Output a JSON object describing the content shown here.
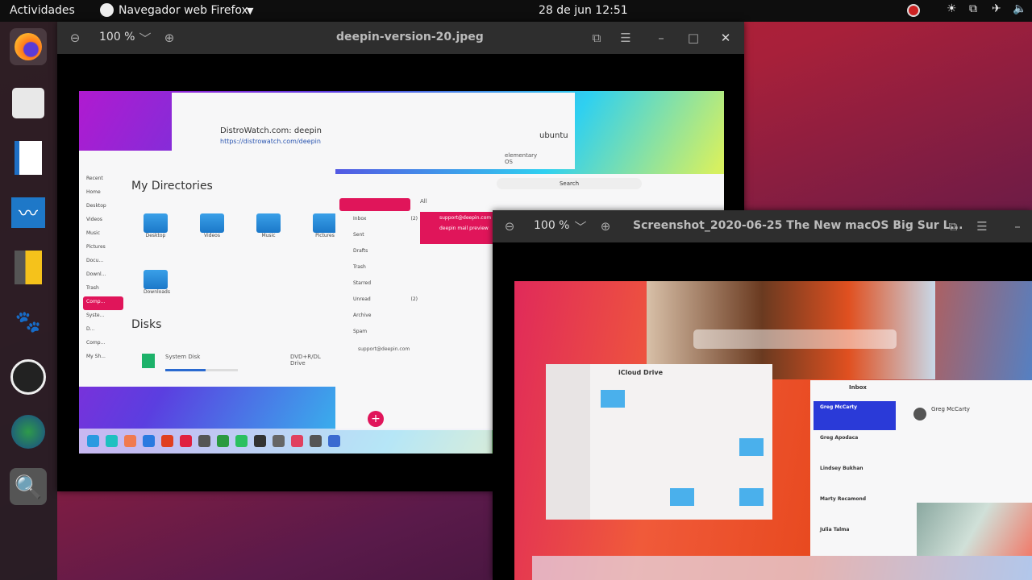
{
  "topbar": {
    "activities": "Actividades",
    "app_menu": "Navegador web Firefox",
    "clock": "28 de jun  12:51"
  },
  "dock": {
    "items": [
      "firefox",
      "files",
      "writer",
      "system-monitor",
      "notes",
      "gimp",
      "obs",
      "globe",
      "search"
    ]
  },
  "window1": {
    "zoom": "100 %",
    "title": "deepin-version-20.jpeg",
    "image": {
      "browser_title": "DistroWatch.com: deepin",
      "browser_url": "https://distrowatch.com/deepin",
      "ubuntu": "ubuntu",
      "elementary": "elementary OS",
      "fm_title": "My Directories",
      "fm_sidebar": [
        "Recent",
        "Home",
        "Desktop",
        "Videos",
        "Music",
        "Pictures",
        "Docu...",
        "Downl...",
        "Trash",
        "Comp...",
        "Syste...",
        "D...",
        "Comp...",
        "My Sh..."
      ],
      "folders": [
        "Desktop",
        "Videos",
        "Music",
        "Pictures",
        "Downloads"
      ],
      "disks_title": "Disks",
      "disk1": "System Disk",
      "disk2": "DVD+R/DL Drive",
      "mail_search": "Search",
      "mail_filter": "All",
      "mail_folders": [
        {
          "name": "Inbox",
          "count": "(2)"
        },
        {
          "name": "Sent",
          "count": ""
        },
        {
          "name": "Drafts",
          "count": ""
        },
        {
          "name": "Trash",
          "count": ""
        },
        {
          "name": "Starred",
          "count": ""
        },
        {
          "name": "Unread",
          "count": "(2)"
        },
        {
          "name": "Archive",
          "count": ""
        },
        {
          "name": "Spam",
          "count": ""
        }
      ],
      "mail_account": "support@deepin.com",
      "mail_subject": "deepin mail preview",
      "mail_preview": "deepin mail preview"
    }
  },
  "window2": {
    "zoom": "100 %",
    "title": "Screenshot_2020-06-25 The New macOS Big Sur L...",
    "image": {
      "finder_title": "iCloud Drive",
      "mail_title": "Inbox",
      "mail_items": [
        "Greg McCarty",
        "Greg Apodaca",
        "Lindsey Bukhan",
        "Marty Recamond",
        "Julia Talma"
      ],
      "mail_sender": "Greg McCarty"
    }
  }
}
